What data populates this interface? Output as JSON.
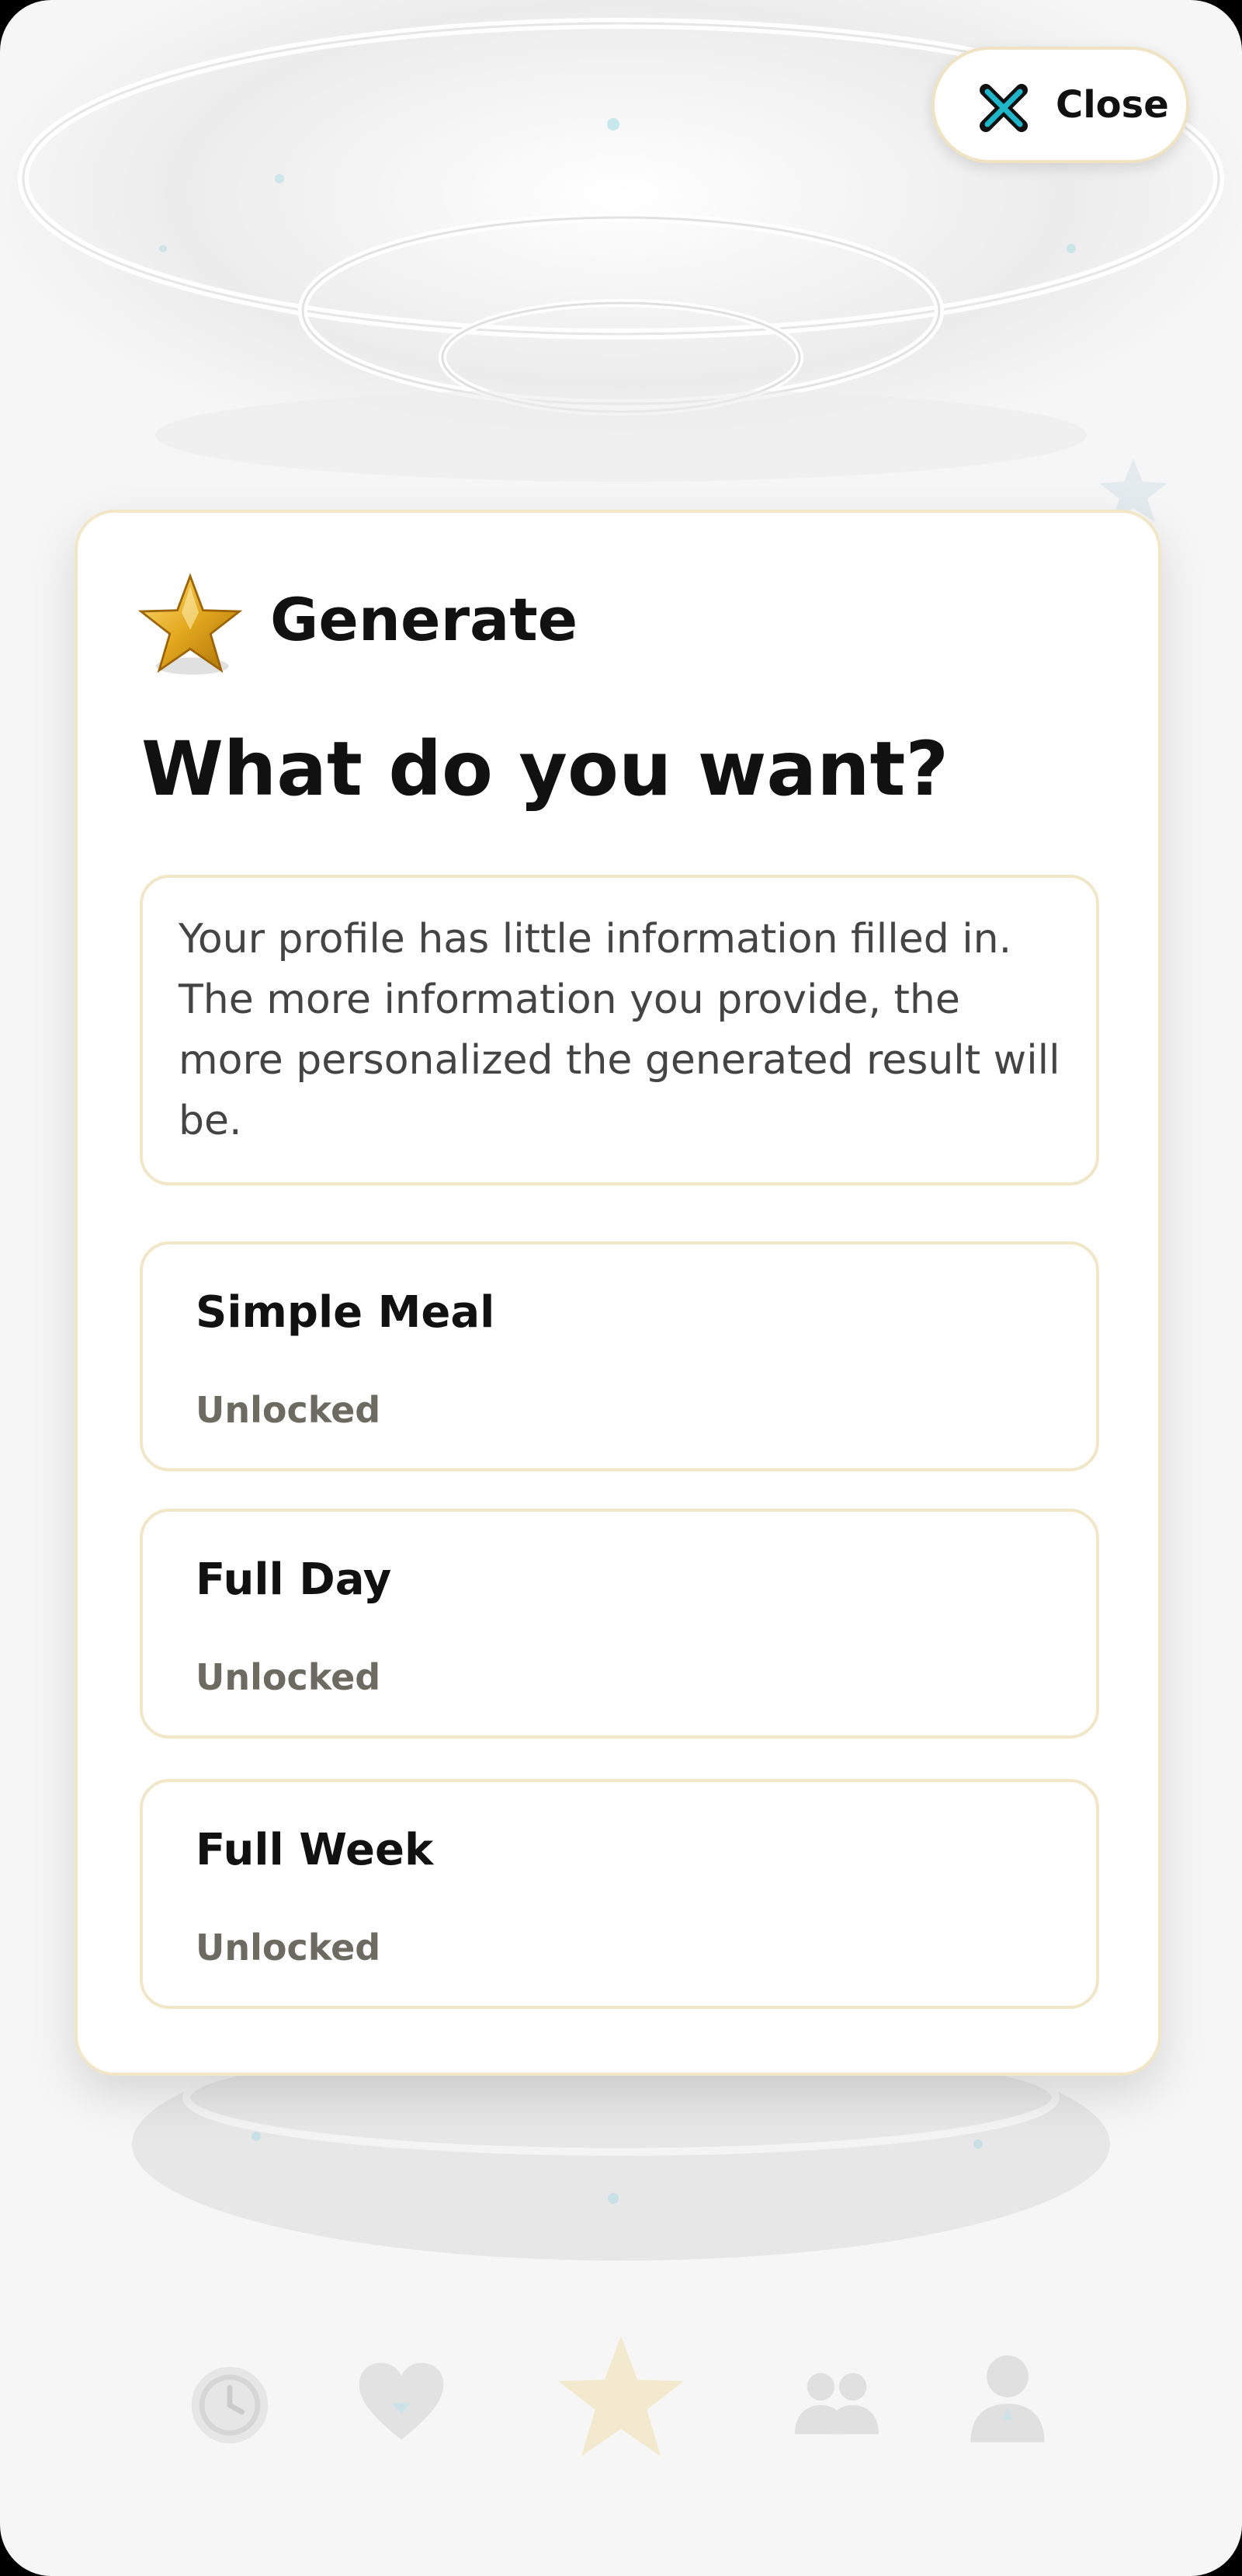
{
  "close_button": {
    "label": "Close",
    "icon": "close-icon",
    "accent_color": "#1fb6c9"
  },
  "card": {
    "icon": "star-icon",
    "heading": "Generate",
    "question": "What do you want?",
    "info_text": "Your profile has little information filled in. The more information you provide, the more personalized the generated result will be.",
    "options": [
      {
        "title": "Simple Meal",
        "status": "Unlocked"
      },
      {
        "title": "Full Day",
        "status": "Unlocked"
      },
      {
        "title": "Full Week",
        "status": "Unlocked"
      }
    ]
  },
  "bottom_nav": {
    "items": [
      {
        "icon": "clock-icon"
      },
      {
        "icon": "heart-icon"
      },
      {
        "icon": "star-icon"
      },
      {
        "icon": "group-icon"
      },
      {
        "icon": "profile-icon"
      }
    ]
  },
  "colors": {
    "gold": "#d9a21a",
    "card_border": "#f1e6c8",
    "status_text": "#6b6b62"
  }
}
